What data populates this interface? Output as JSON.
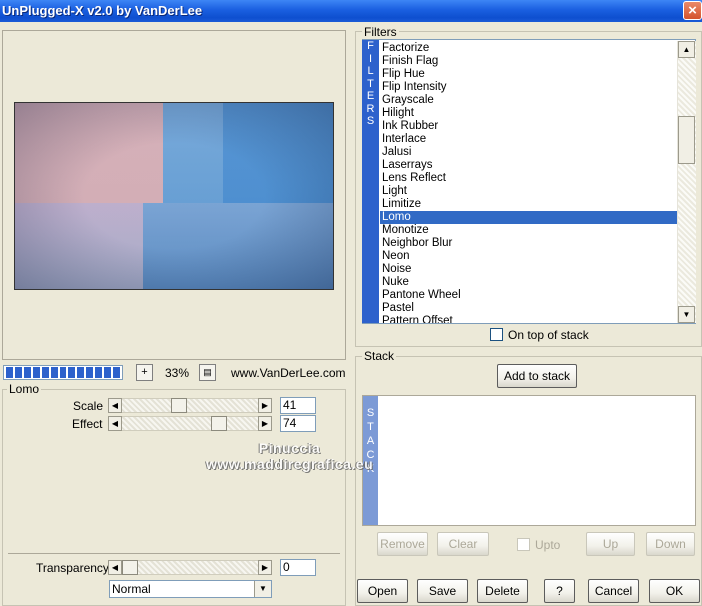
{
  "window": {
    "title": "UnPlugged-X v2.0 by VanDerLee",
    "close_label": "×"
  },
  "preview": {
    "zoom": "33%",
    "website": "www.VanDerLee.com",
    "progress": 1.0
  },
  "controls": {
    "group_title": "Lomo",
    "sliders": [
      {
        "label": "Scale",
        "value": "41",
        "fraction": 0.41
      },
      {
        "label": "Effect",
        "value": "74",
        "fraction": 0.74
      }
    ],
    "transparency": {
      "label": "Transparency",
      "value": "0",
      "fraction": 0.0
    },
    "blend_mode": {
      "selected": "Normal"
    }
  },
  "filters": {
    "group_title": "Filters",
    "side_letters": [
      "F",
      "I",
      "L",
      "T",
      "E",
      "R",
      "S"
    ],
    "items": [
      "Factorize",
      "Finish Flag",
      "Flip Hue",
      "Flip Intensity",
      "Grayscale",
      "Hilight",
      "Ink Rubber",
      "Interlace",
      "Jalusi",
      "Laserrays",
      "Lens Reflect",
      "Light",
      "Limitize",
      "Lomo",
      "Monotize",
      "Neighbor Blur",
      "Neon",
      "Noise",
      "Nuke",
      "Pantone Wheel",
      "Pastel",
      "Pattern Offset"
    ],
    "selected_index": 13,
    "on_top_label": "On top of stack"
  },
  "stack": {
    "group_title": "Stack",
    "add_label": "Add to stack",
    "side_letters": [
      "S",
      "T",
      "A",
      "C",
      "K"
    ],
    "remove_label": "Remove",
    "clear_label": "Clear",
    "upto_label": "Upto",
    "up_label": "Up",
    "down_label": "Down"
  },
  "buttons": {
    "open": "Open",
    "save": "Save",
    "delete": "Delete",
    "help": "?",
    "cancel": "Cancel",
    "ok": "OK"
  },
  "watermark": {
    "line1": "Pinuccia",
    "line2": "www.maddiregrafica.eu"
  },
  "colors": {
    "titlebar": "#0e4fd0",
    "selection": "#316ac5",
    "filter_side": "#2d61cc",
    "stack_side": "#7c9ad6"
  }
}
